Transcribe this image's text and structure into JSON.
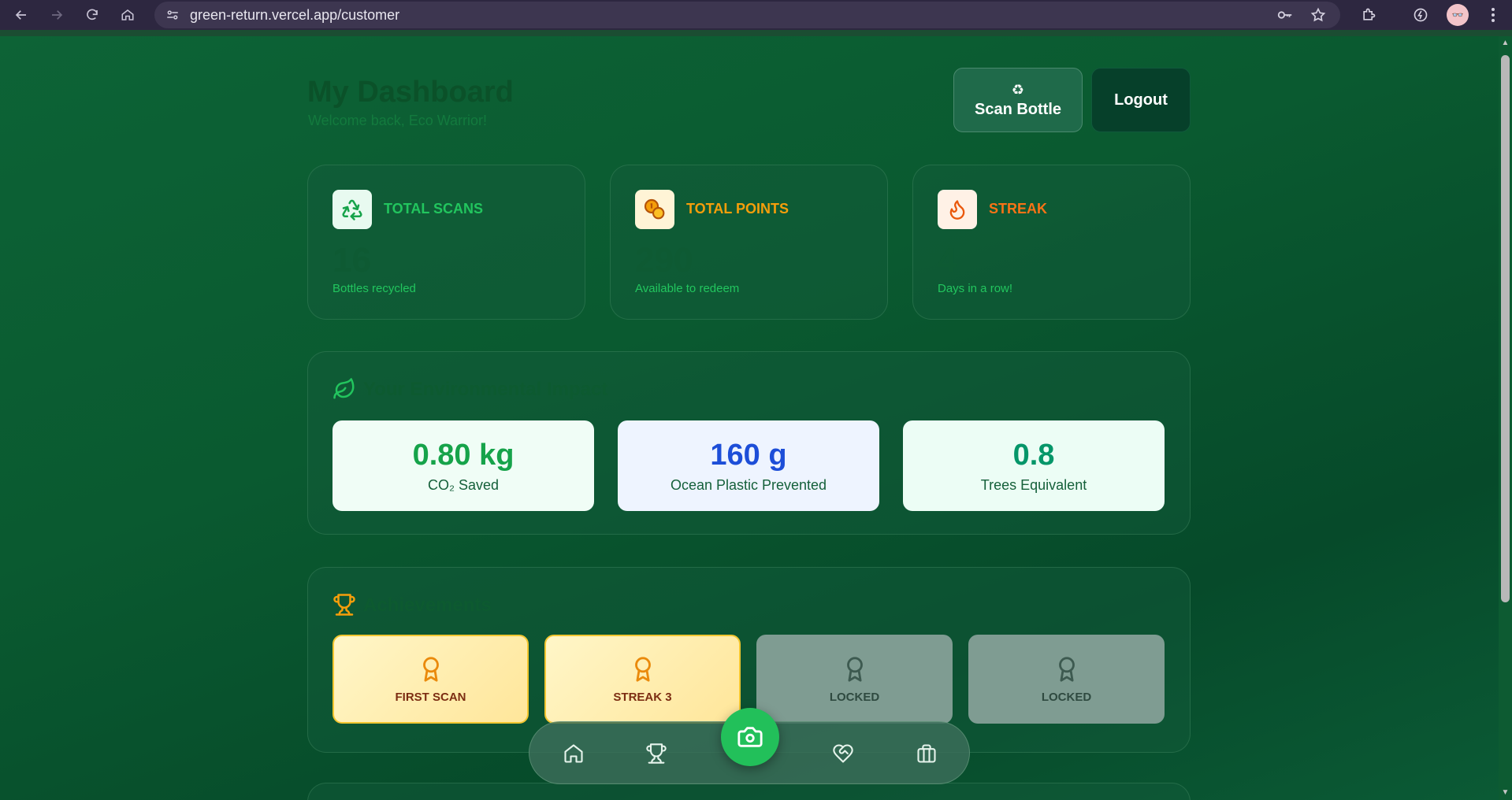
{
  "browser": {
    "url": "green-return.vercel.app/customer",
    "profile_initials": "👓"
  },
  "header": {
    "title": "My Dashboard",
    "subtitle": "Welcome back, Eco Warrior!",
    "scan_button": "Scan Bottle",
    "logout_button": "Logout"
  },
  "stats": [
    {
      "label": "TOTAL SCANS",
      "value": "16",
      "desc": "Bottles recycled",
      "color": "#22c55e"
    },
    {
      "label": "TOTAL POINTS",
      "value": "290",
      "desc": "Available to redeem",
      "color": "#f59e0b"
    },
    {
      "label": "STREAK",
      "value": "4",
      "desc": "Days in a row!",
      "color": "#f97316"
    }
  ],
  "impact": {
    "title": "Your Environmental Impact",
    "items": [
      {
        "value": "0.80 kg",
        "label": "CO₂ Saved",
        "color": "#16a34a"
      },
      {
        "value": "160 g",
        "label": "Ocean Plastic Prevented",
        "color": "#1d4ed8"
      },
      {
        "value": "0.8",
        "label": "Trees Equivalent",
        "color": "#059669"
      }
    ]
  },
  "achievements": {
    "title": "Achievements",
    "badges": [
      {
        "label": "FIRST SCAN",
        "state": "unlocked"
      },
      {
        "label": "STREAK 3",
        "state": "unlocked"
      },
      {
        "label": "LOCKED",
        "state": "locked"
      },
      {
        "label": "LOCKED",
        "state": "locked"
      }
    ]
  },
  "bottom_nav": {
    "items": [
      "home-icon",
      "trophy-icon",
      "camera-icon",
      "heart-handshake-icon",
      "briefcase-icon"
    ]
  }
}
